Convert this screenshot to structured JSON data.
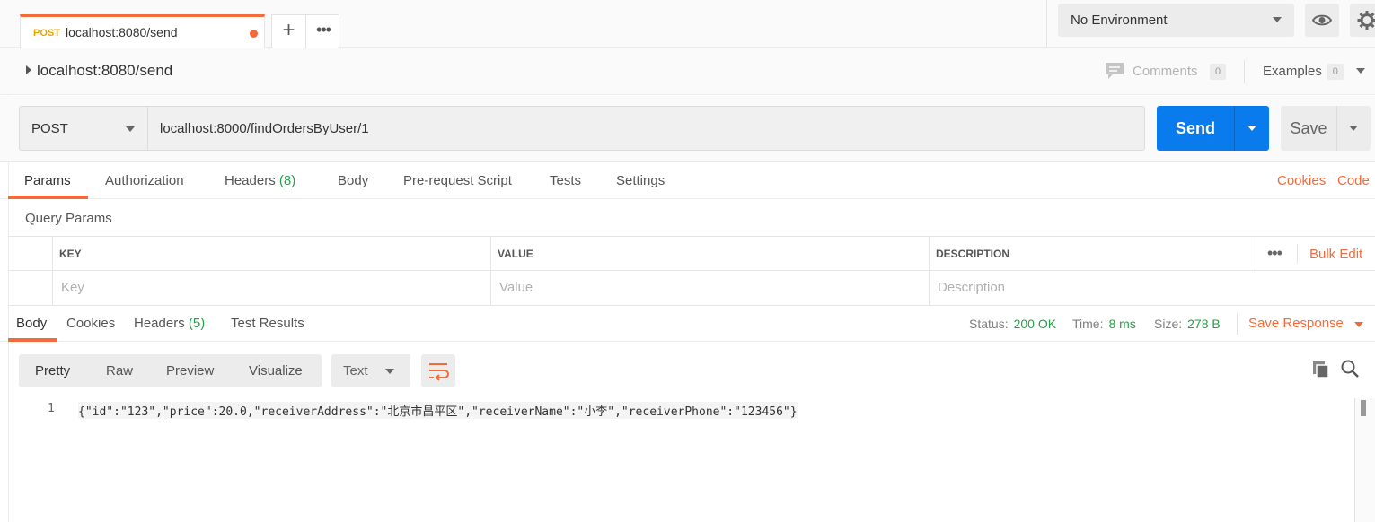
{
  "top_tab": {
    "method": "POST",
    "name": "localhost:8080/send",
    "new_tab_icon": "+",
    "more_icon": "•••"
  },
  "environment": {
    "selected": "No Environment",
    "eye_icon": "eye-icon",
    "settings_icon": "gear-icon"
  },
  "request": {
    "title": "localhost:8080/send",
    "comments_label": "Comments",
    "comments_count": "0",
    "examples_label": "Examples",
    "examples_count": "0",
    "method": "POST",
    "url": "localhost:8000/findOrdersByUser/1",
    "send_label": "Send",
    "save_label": "Save"
  },
  "request_tabs": {
    "params": "Params",
    "authorization": "Authorization",
    "headers": "Headers",
    "headers_count": "(8)",
    "body": "Body",
    "prerequest": "Pre-request Script",
    "tests": "Tests",
    "settings": "Settings",
    "cookies": "Cookies",
    "code": "Code"
  },
  "query_params": {
    "title": "Query Params",
    "columns": [
      "KEY",
      "VALUE",
      "DESCRIPTION"
    ],
    "placeholders": [
      "Key",
      "Value",
      "Description"
    ],
    "more_icon": "•••",
    "bulk_edit": "Bulk Edit"
  },
  "response_tabs": {
    "body": "Body",
    "cookies": "Cookies",
    "headers": "Headers",
    "headers_count": "(5)",
    "test_results": "Test Results",
    "status_label": "Status:",
    "status_value": "200 OK",
    "time_label": "Time:",
    "time_value": "8 ms",
    "size_label": "Size:",
    "size_value": "278 B",
    "save_response": "Save Response"
  },
  "response_view": {
    "modes": [
      "Pretty",
      "Raw",
      "Preview",
      "Visualize"
    ],
    "format": "Text",
    "wrap_icon": "wrap-lines-icon",
    "copy_icon": "copy-icon",
    "search_icon": "search-icon"
  },
  "response_body": {
    "line_number": "1",
    "line_text": "{\"id\":\"123\",\"price\":20.0,\"receiverAddress\":\"北京市昌平区\",\"receiverName\":\"小李\",\"receiverPhone\":\"123456\"}"
  },
  "colors": {
    "accent": "#f26b3a",
    "send_blue": "#097bed",
    "status_green": "#26a047",
    "method_post": "#e8a400"
  }
}
